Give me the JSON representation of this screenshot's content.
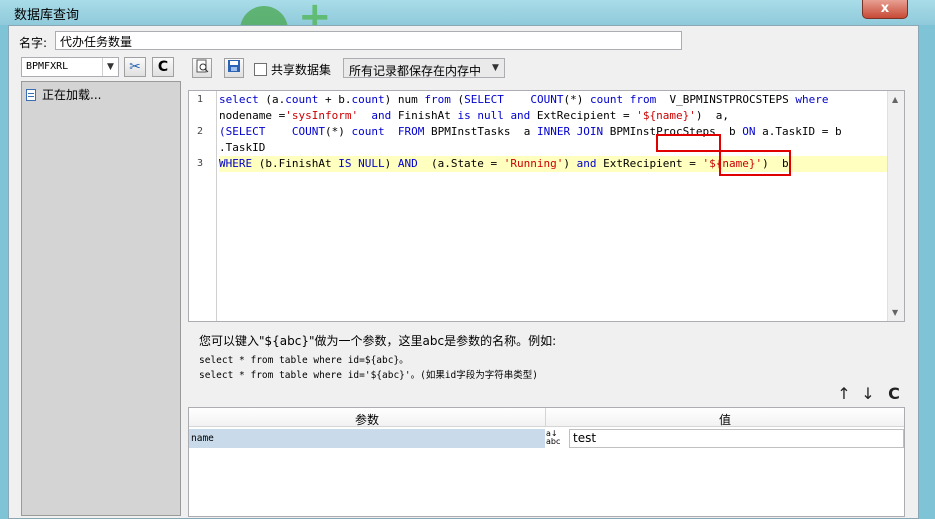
{
  "window": {
    "title": "数据库查询",
    "close_label": "x"
  },
  "name_row": {
    "label": "名字:",
    "value": "代办任务数量"
  },
  "datasource": {
    "selected": "BPMFXRL",
    "arrow": "▼"
  },
  "left_toolbar": {
    "connect_icon": "✂",
    "refresh_icon": "C"
  },
  "tree": {
    "loading_text": "正在加载..."
  },
  "toolbar": {
    "share_label": "共享数据集",
    "memory_option": "所有记录都保存在内存中",
    "memory_arrow": "▼"
  },
  "editor": {
    "line_numbers": [
      "1",
      "2",
      "3"
    ],
    "lines": [
      [
        {
          "t": "select",
          "c": "kw"
        },
        {
          "t": " (a.",
          "c": "plain"
        },
        {
          "t": "count",
          "c": "kw"
        },
        {
          "t": " + b.",
          "c": "plain"
        },
        {
          "t": "count",
          "c": "kw"
        },
        {
          "t": ") num ",
          "c": "plain"
        },
        {
          "t": "from",
          "c": "kw"
        },
        {
          "t": " (",
          "c": "plain"
        },
        {
          "t": "SELECT",
          "c": "kw"
        },
        {
          "t": "    ",
          "c": "plain"
        },
        {
          "t": "COUNT",
          "c": "fn"
        },
        {
          "t": "(*) ",
          "c": "plain"
        },
        {
          "t": "count",
          "c": "kw"
        },
        {
          "t": " ",
          "c": "plain"
        },
        {
          "t": "from",
          "c": "kw"
        },
        {
          "t": "  V_BPMINSTPROCSTEPS ",
          "c": "plain"
        },
        {
          "t": "where",
          "c": "kw"
        }
      ],
      [
        {
          "t": "nodename =",
          "c": "plain"
        },
        {
          "t": "'sysInform'",
          "c": "str"
        },
        {
          "t": "  ",
          "c": "plain"
        },
        {
          "t": "and",
          "c": "kw"
        },
        {
          "t": " FinishAt ",
          "c": "plain"
        },
        {
          "t": "is null",
          "c": "kw"
        },
        {
          "t": " ",
          "c": "plain"
        },
        {
          "t": "and",
          "c": "kw"
        },
        {
          "t": " ExtRecipient = ",
          "c": "plain"
        },
        {
          "t": "'${name}'",
          "c": "str"
        },
        {
          "t": ")  a,",
          "c": "plain"
        }
      ],
      [
        {
          "t": "(SELECT",
          "c": "kw"
        },
        {
          "t": "    ",
          "c": "plain"
        },
        {
          "t": "COUNT",
          "c": "fn"
        },
        {
          "t": "(*) ",
          "c": "plain"
        },
        {
          "t": "count",
          "c": "kw"
        },
        {
          "t": "  ",
          "c": "plain"
        },
        {
          "t": "FROM",
          "c": "kw"
        },
        {
          "t": " BPMInstTasks  a ",
          "c": "plain"
        },
        {
          "t": "INNER JOIN",
          "c": "kw"
        },
        {
          "t": " BPMInstProcSteps  b ",
          "c": "plain"
        },
        {
          "t": "ON",
          "c": "kw"
        },
        {
          "t": " a.TaskID = b",
          "c": "plain"
        }
      ],
      [
        {
          "t": ".TaskID",
          "c": "plain"
        }
      ],
      [
        {
          "t": "WHERE",
          "c": "kw"
        },
        {
          "t": " (b.FinishAt ",
          "c": "plain"
        },
        {
          "t": "IS NULL",
          "c": "kw"
        },
        {
          "t": ") ",
          "c": "plain"
        },
        {
          "t": "AND",
          "c": "kw"
        },
        {
          "t": "  (a.State = ",
          "c": "plain"
        },
        {
          "t": "'Running'",
          "c": "str"
        },
        {
          "t": ") ",
          "c": "plain"
        },
        {
          "t": "and",
          "c": "kw"
        },
        {
          "t": " ExtRecipient = ",
          "c": "plain"
        },
        {
          "t": "'${name}'",
          "c": "str"
        },
        {
          "t": ")  b",
          "c": "plain"
        }
      ]
    ]
  },
  "help": {
    "line1": "您可以键入\"${abc}\"做为一个参数，这里abc是参数的名称。例如:",
    "line2": "select * from table where id=${abc}。",
    "line3": "select * from table where id='${abc}'。(如果id字段为字符串类型)"
  },
  "param_toolbar": {
    "up_icon": "↑",
    "down_icon": "↓",
    "refresh_icon": "C"
  },
  "params": {
    "col_param": "参数",
    "col_value": "值",
    "rows": [
      {
        "name": "name",
        "type_top": "a↓",
        "type_bottom": "abc",
        "value": "test"
      }
    ]
  },
  "colors": {
    "highlight_box": "#e00000",
    "keyword": "#0000cc",
    "string": "#cc0000",
    "current_line": "#ffffc0"
  }
}
